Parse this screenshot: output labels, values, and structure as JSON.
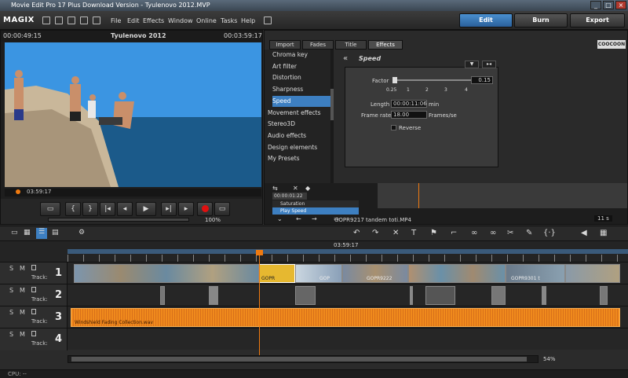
{
  "window": {
    "title": "Movie Edit Pro 17 Plus Download Version - Tyulenovo 2012.MVP"
  },
  "menubar": {
    "logo": "MAGIX",
    "items": [
      "File",
      "Edit",
      "Effects",
      "Window",
      "Online",
      "Tasks",
      "Help"
    ],
    "modes": {
      "edit": "Edit",
      "burn": "Burn",
      "export": "Export"
    }
  },
  "preview": {
    "time_left": "00:00:49:15",
    "title": "Tyulenovo 2012",
    "time_right": "00:03:59:17",
    "scrub_time": "03:59:17",
    "zoom": "100%"
  },
  "effects": {
    "tabs": [
      "Import",
      "Fades",
      "Title",
      "Effects"
    ],
    "active_tab": "Effects",
    "brand": "COOCOON",
    "list": [
      {
        "label": "Chroma key",
        "sub": true
      },
      {
        "label": "Art filter",
        "sub": true
      },
      {
        "label": "Distortion",
        "sub": true
      },
      {
        "label": "Sharpness",
        "sub": true
      },
      {
        "label": "Speed",
        "sub": true,
        "selected": true
      },
      {
        "label": "Movement effects",
        "sub": false
      },
      {
        "label": "Stereo3D",
        "sub": false
      },
      {
        "label": "Audio effects",
        "sub": false
      },
      {
        "label": "Design elements",
        "sub": false
      },
      {
        "label": "My Presets",
        "sub": false
      }
    ],
    "speed": {
      "heading": "Speed",
      "factor_label": "Factor",
      "factor_value": "0.15",
      "factor_ticks": [
        "0.25",
        "1",
        "2",
        "3",
        "4"
      ],
      "length_label": "Length",
      "length_value": "00:00:11:06",
      "length_unit": "min",
      "framerate_label": "Frame rate",
      "framerate_value": "18.00",
      "framerate_unit": "Frames/se",
      "reverse_label": "Reverse"
    },
    "lower": {
      "time": "00:00:01:22",
      "row1": "Saturation",
      "row2": "Play Speed",
      "clip_name": "GOPR9217 tandem toti.MP4",
      "duration": "11 s"
    }
  },
  "timeline": {
    "ruler_center": "03:59:17",
    "tracks": [
      {
        "num": "1",
        "label": "Track:"
      },
      {
        "num": "2",
        "label": "Track:"
      },
      {
        "num": "3",
        "label": "Track:"
      },
      {
        "num": "4",
        "label": "Track:"
      }
    ],
    "clip_labels": {
      "a": "GOPR",
      "b": "GOP",
      "c": "GOPR9222",
      "d": "GOPR9301 t"
    },
    "audio_label": "Windshield Fading Collection.wav",
    "zoom": "54%"
  },
  "status": {
    "cpu": "CPU: --"
  },
  "colors": {
    "accent": "#3d7fc1",
    "audio": "#f08a1c",
    "playhead": "#f07a10",
    "edit_active": "#2a5f9a"
  }
}
